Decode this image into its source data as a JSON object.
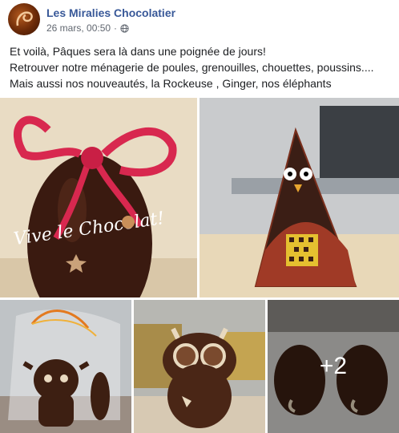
{
  "header": {
    "page_name": "Les Miralies Chocolatier",
    "timestamp": "26 mars, 00:50",
    "separator": "·",
    "audience_icon": "globe-icon"
  },
  "post": {
    "lines": [
      "Et voilà, Pâques sera là dans une poignée de jours!",
      "Retrouver notre ménagerie de poules, grenouilles, chouettes, poussins....",
      "Mais aussi nos nouveautés, la Rockeuse , Ginger, nos éléphants"
    ]
  },
  "photos": {
    "egg_script": "Vive le Chocolat!",
    "more_count": "+2"
  },
  "colors": {
    "link": "#385898",
    "meta": "#616770",
    "text": "#1c1e21"
  }
}
